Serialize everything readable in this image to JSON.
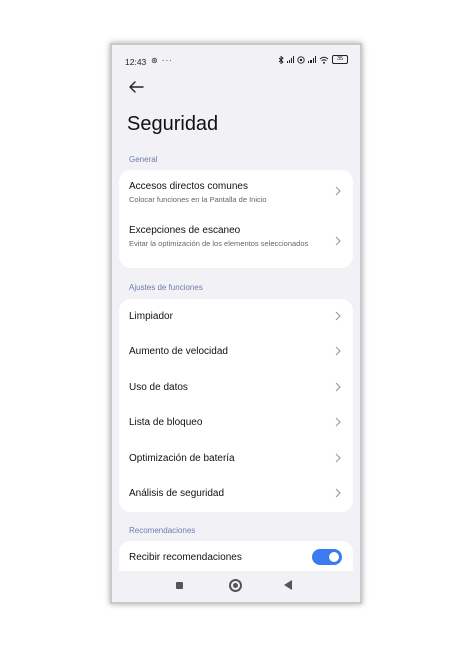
{
  "status_bar": {
    "time": "12:43",
    "left_icons": "⊛ ···",
    "battery": "35"
  },
  "header": {
    "title": "Seguridad"
  },
  "sections": {
    "general": {
      "label": "General",
      "items": [
        {
          "title": "Accesos directos comunes",
          "subtitle": "Colocar funciones en la Pantalla de Inicio"
        },
        {
          "title": "Excepciones de escaneo",
          "subtitle": "Evitar la optimización de los elementos seleccionados"
        }
      ]
    },
    "functions": {
      "label": "Ajustes de funciones",
      "items": [
        {
          "title": "Limpiador"
        },
        {
          "title": "Aumento de velocidad"
        },
        {
          "title": "Uso de datos"
        },
        {
          "title": "Lista de bloqueo"
        },
        {
          "title": "Optimización de batería"
        },
        {
          "title": "Análisis de seguridad"
        }
      ]
    },
    "recommendations": {
      "label": "Recomendaciones",
      "items": [
        {
          "title": "Recibir recomendaciones",
          "toggle_on": true
        }
      ]
    }
  },
  "colors": {
    "accent": "#3a7bf0",
    "section_label": "#6c7bb0",
    "background": "#f2f2f6"
  }
}
